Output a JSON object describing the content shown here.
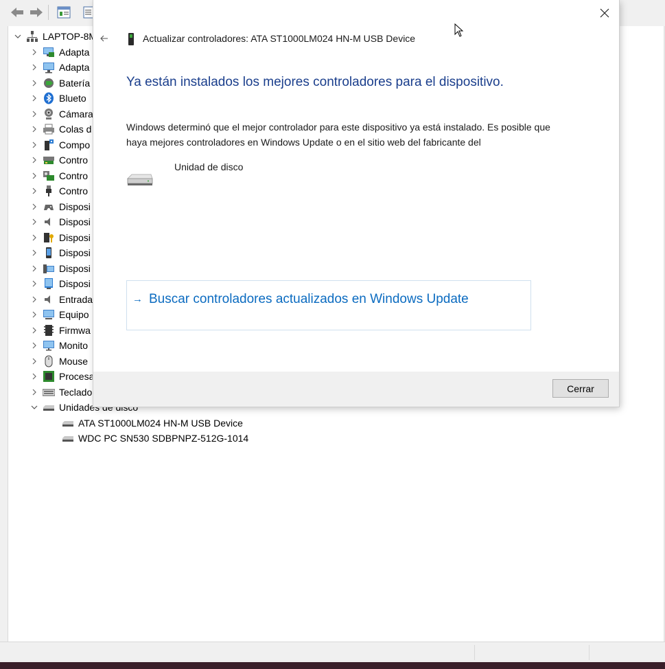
{
  "device_manager": {
    "computer_name": "LAPTOP-8M",
    "categories": [
      {
        "label": "Adapta",
        "icon": "network-adapter-icon"
      },
      {
        "label": "Adapta",
        "icon": "display-adapter-icon"
      },
      {
        "label": "Batería",
        "icon": "battery-icon"
      },
      {
        "label": "Blueto",
        "icon": "bluetooth-icon"
      },
      {
        "label": "Cámara",
        "icon": "camera-icon"
      },
      {
        "label": "Colas d",
        "icon": "printer-icon"
      },
      {
        "label": "Compo",
        "icon": "software-component-icon"
      },
      {
        "label": "Contro",
        "icon": "storage-controller-icon"
      },
      {
        "label": "Contro",
        "icon": "sound-controller-icon"
      },
      {
        "label": "Contro",
        "icon": "usb-controller-icon"
      },
      {
        "label": "Disposi",
        "icon": "hid-device-icon"
      },
      {
        "label": "Disposi",
        "icon": "audio-device-icon"
      },
      {
        "label": "Disposi",
        "icon": "security-device-icon"
      },
      {
        "label": "Disposi",
        "icon": "portable-device-icon"
      },
      {
        "label": "Disposi",
        "icon": "system-device-icon"
      },
      {
        "label": "Disposi",
        "icon": "software-device-icon"
      },
      {
        "label": "Entrada",
        "icon": "audio-input-icon"
      },
      {
        "label": "Equipo",
        "icon": "computer-icon"
      },
      {
        "label": "Firmwa",
        "icon": "firmware-icon"
      },
      {
        "label": "Monito",
        "icon": "monitor-icon"
      },
      {
        "label": "Mouse",
        "icon": "mouse-icon"
      },
      {
        "label": "Procesa",
        "icon": "processor-icon"
      },
      {
        "label": "Teclado",
        "icon": "keyboard-icon"
      }
    ],
    "expanded_category": "Unidades de disco",
    "disk_drives": [
      "ATA ST1000LM024 HN-M USB Device",
      "WDC PC SN530 SDBPNPZ-512G-1014"
    ]
  },
  "dialog": {
    "title": "Actualizar controladores: ATA ST1000LM024 HN-M USB Device",
    "headline": "Ya están instalados los mejores controladores para el dispositivo.",
    "body": "Windows determinó que el mejor controlador para este dispositivo ya está instalado. Es posible que haya mejores controladores en Windows Update o en el sitio web del fabricante del",
    "device_label": "Unidad de disco",
    "wu_arrow": "→",
    "wu_link": "Buscar controladores actualizados en Windows Update",
    "close_button": "Cerrar",
    "headline_color": "#1a3e8c",
    "link_color": "#0b6bc0"
  }
}
